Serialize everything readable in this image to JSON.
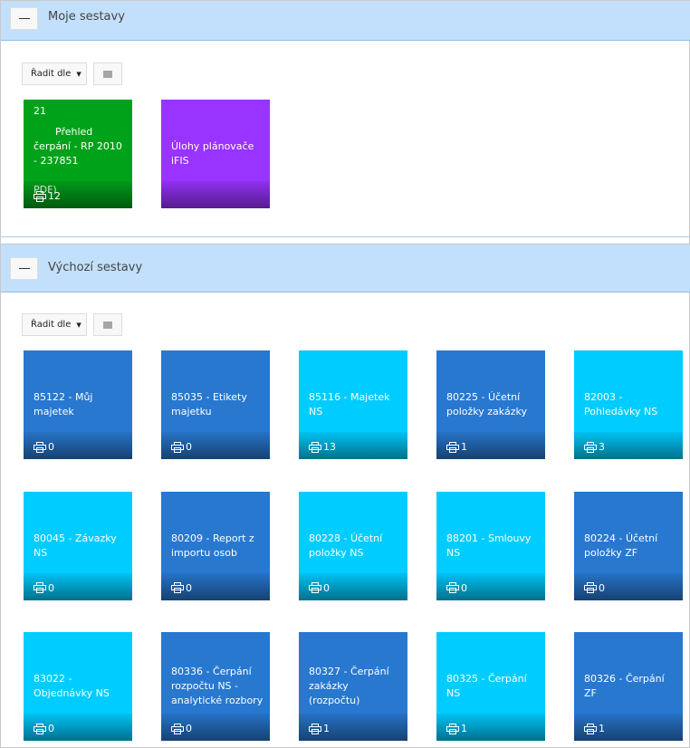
{
  "sections": [
    {
      "title": "Moje sestavy",
      "sort_label": "Řadit dle",
      "tiles": [
        {
          "prefix": "21",
          "name": "Přehled čerpání - RP 2010 - 237851",
          "suffix": "PDF)",
          "count": "12",
          "color": "green"
        },
        {
          "name": "Úlohy plánovače iFIS",
          "color": "purple"
        }
      ]
    },
    {
      "title": "Výchozí sestavy",
      "sort_label": "Řadit dle",
      "tiles": [
        {
          "name": "85122 - Můj majetek",
          "count": "0",
          "color": "blue"
        },
        {
          "name": "85035 - Etikety majetku",
          "count": "0",
          "color": "blue"
        },
        {
          "name": "85116 - Majetek NS",
          "count": "13",
          "color": "cyan"
        },
        {
          "name": "80225 - Účetní položky zakázky",
          "count": "1",
          "color": "blue"
        },
        {
          "name": "82003 - Pohledávky NS",
          "count": "3",
          "color": "cyan"
        },
        {
          "name": "80045 - Závazky NS",
          "count": "0",
          "color": "cyan"
        },
        {
          "name": "80209 - Report z importu osob",
          "count": "0",
          "color": "blue"
        },
        {
          "name": "80228 - Účetní položky NS",
          "count": "0",
          "color": "cyan"
        },
        {
          "name": "88201 - Smlouvy NS",
          "count": "0",
          "color": "cyan"
        },
        {
          "name": "80224 - Účetní položky ZF",
          "count": "0",
          "color": "blue"
        },
        {
          "name": "83022 - Objednávky NS",
          "count": "0",
          "color": "cyan"
        },
        {
          "name": "80336 - Čerpání rozpočtu NS - analytické rozbory",
          "count": "0",
          "color": "blue"
        },
        {
          "name": "80327 - Čerpání zakázky (rozpočtu)",
          "count": "1",
          "color": "blue"
        },
        {
          "name": "80325 - Čerpání NS",
          "count": "1",
          "color": "cyan"
        },
        {
          "name": "80326 - Čerpání ZF",
          "count": "1",
          "color": "blue"
        }
      ]
    }
  ]
}
